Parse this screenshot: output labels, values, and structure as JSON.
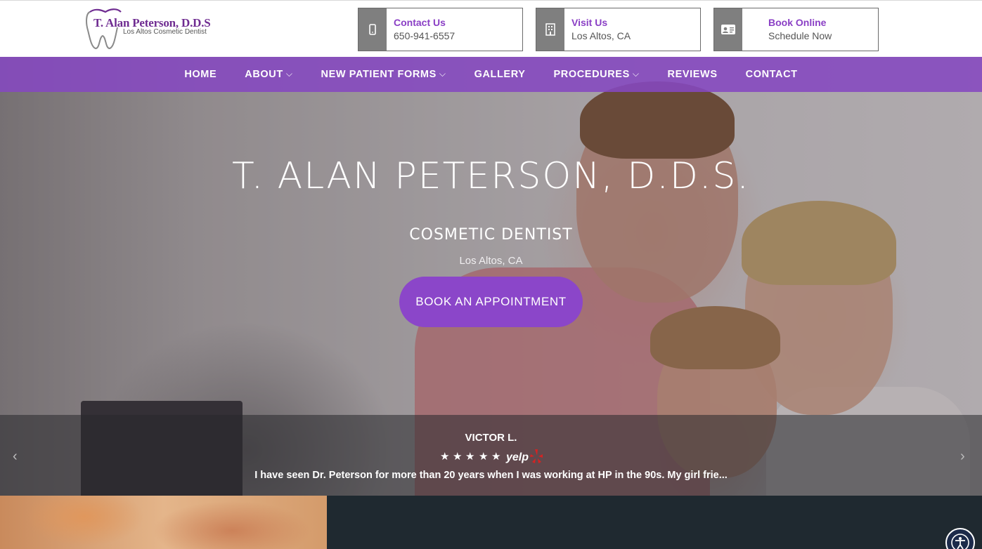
{
  "logo": {
    "name": "T. Alan Peterson, D.D.S",
    "tagline": "Los Altos Cosmetic Dentist",
    "icon": "tooth-icon"
  },
  "header_boxes": [
    {
      "title": "Contact Us",
      "sub": "650-941-6557",
      "icon": "mobile-phone-icon"
    },
    {
      "title": "Visit Us",
      "sub": "Los Altos, CA",
      "icon": "building-icon"
    },
    {
      "title": "Book Online",
      "sub": "Schedule Now",
      "icon": "id-card-icon"
    }
  ],
  "nav": {
    "items": [
      {
        "label": "HOME",
        "dropdown": false
      },
      {
        "label": "ABOUT",
        "dropdown": true
      },
      {
        "label": "NEW PATIENT FORMS",
        "dropdown": true
      },
      {
        "label": "GALLERY",
        "dropdown": false
      },
      {
        "label": "PROCEDURES",
        "dropdown": true
      },
      {
        "label": "REVIEWS",
        "dropdown": false
      },
      {
        "label": "CONTACT",
        "dropdown": false
      }
    ],
    "chevron": "⌵"
  },
  "hero": {
    "title": "T. ALAN PETERSON, D.D.S.",
    "subtitle": "COSMETIC DENTIST",
    "location": "Los Altos, CA",
    "cta": "BOOK AN APPOINTMENT"
  },
  "review": {
    "name": "VICTOR L.",
    "rating": 5,
    "source": "yelp",
    "text": "I have seen Dr. Peterson for more than 20 years when I was working at HP in the 90s. My girl frie..."
  },
  "colors": {
    "brand_purple": "#8b46c9",
    "nav_purple": "#8548c0",
    "dark_panel": "#1f2930"
  }
}
